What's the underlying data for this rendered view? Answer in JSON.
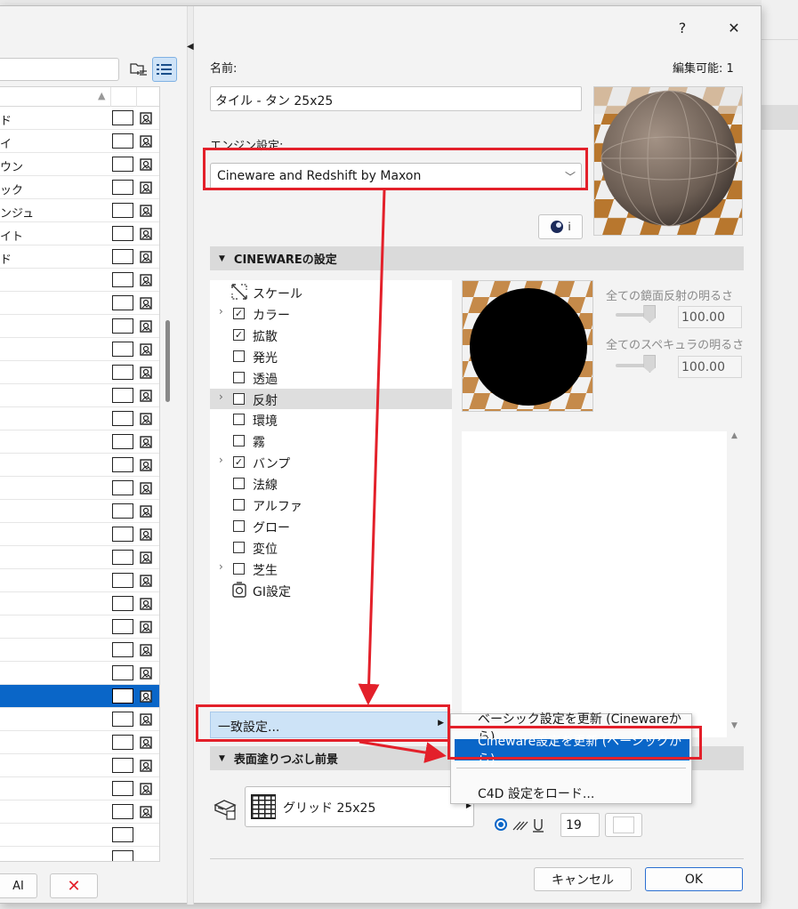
{
  "window": {
    "help_label": "?",
    "close_label": "✕"
  },
  "left": {
    "search": {
      "value": "",
      "placeholder": ""
    },
    "rows": [
      {
        "label": "ド",
        "pattern": "grid"
      },
      {
        "label": "イ",
        "pattern": "brick"
      },
      {
        "label": "ウン",
        "pattern": "brick"
      },
      {
        "label": "ック",
        "pattern": "brick"
      },
      {
        "label": "ンジュ",
        "pattern": "brick"
      },
      {
        "label": "イト",
        "pattern": "brick"
      },
      {
        "label": "ド",
        "pattern": "brick"
      },
      {
        "label": "",
        "pattern": "grid"
      },
      {
        "label": "",
        "pattern": "grid"
      },
      {
        "label": "",
        "pattern": "grid"
      },
      {
        "label": "",
        "pattern": "grid"
      },
      {
        "label": "",
        "pattern": "grid"
      },
      {
        "label": "",
        "pattern": "grid"
      },
      {
        "label": "",
        "pattern": "grid"
      },
      {
        "label": "",
        "pattern": "grid"
      },
      {
        "label": "",
        "pattern": "grid"
      },
      {
        "label": "",
        "pattern": "grid"
      },
      {
        "label": "",
        "pattern": "grid"
      },
      {
        "label": "",
        "pattern": "grid"
      },
      {
        "label": "",
        "pattern": "grid"
      },
      {
        "label": "",
        "pattern": "grid"
      },
      {
        "label": "",
        "pattern": "grid"
      },
      {
        "label": "",
        "pattern": "grid"
      },
      {
        "label": "",
        "pattern": "grid"
      },
      {
        "label": "",
        "pattern": "grid"
      },
      {
        "label": "",
        "pattern": "grid",
        "selected": true
      },
      {
        "label": "",
        "pattern": "grid"
      },
      {
        "label": "",
        "pattern": "check"
      },
      {
        "label": "",
        "pattern": "grid"
      },
      {
        "label": "",
        "pattern": "grid"
      },
      {
        "label": "",
        "pattern": "grid"
      },
      {
        "label": "",
        "pattern": "blank"
      },
      {
        "label": "",
        "pattern": "blank"
      }
    ],
    "font_button_label": "AI",
    "delete_button_label": "✕"
  },
  "header": {
    "name_label": "名前:",
    "editable_label": "編集可能: 1",
    "name_value": "タイル - タン 25x25",
    "engine_label": "エンジン設定:",
    "engine_value": "Cineware and Redshift by Maxon",
    "info_button_label": "i"
  },
  "cineware": {
    "title": "CINEWAREの設定",
    "tree": [
      {
        "label": "スケール",
        "type": "icon",
        "icon": "scale"
      },
      {
        "label": "カラー",
        "checked": true,
        "expandable": true
      },
      {
        "label": "拡散",
        "checked": true
      },
      {
        "label": "発光",
        "checked": false
      },
      {
        "label": "透過",
        "checked": false
      },
      {
        "label": "反射",
        "checked": false,
        "expandable": true,
        "highlighted": true
      },
      {
        "label": "環境",
        "checked": false
      },
      {
        "label": "霧",
        "checked": false
      },
      {
        "label": "バンプ",
        "checked": true,
        "expandable": true
      },
      {
        "label": "法線",
        "checked": false
      },
      {
        "label": "アルファ",
        "checked": false
      },
      {
        "label": "グロー",
        "checked": false
      },
      {
        "label": "変位",
        "checked": false
      },
      {
        "label": "芝生",
        "checked": false,
        "expandable": true
      },
      {
        "label": "GI設定",
        "type": "icon",
        "icon": "gi"
      }
    ],
    "specular_label": "全ての鏡面反射の明るさ",
    "specular_value": "100.00",
    "specular_level": 0.6,
    "specular2_label": "全てのスペキュラの明るさ",
    "specular2_value": "100.00",
    "specular2_level": 0.6
  },
  "match": {
    "button_label": "一致設定..."
  },
  "menu": {
    "items": [
      "ベーシック設定を更新 (Cinewareから)",
      "Cineware設定を更新 (ベーシックから)",
      "C4D 設定をロード..."
    ]
  },
  "surface": {
    "title": "表面塗りつぶし前景",
    "fill_value": "グリッド 25x25",
    "pen_value": "19"
  },
  "footer": {
    "cancel_label": "キャンセル",
    "ok_label": "OK"
  },
  "colors": {
    "accent": "#0a66c8",
    "annotation": "#e3202a"
  }
}
